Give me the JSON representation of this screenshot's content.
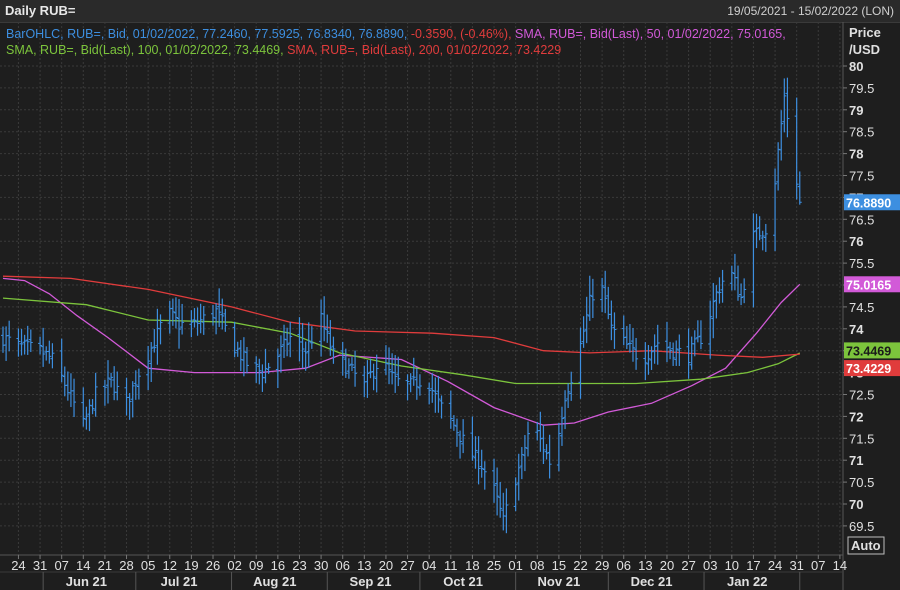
{
  "header": {
    "title": "Daily RUB=",
    "date_range": "19/05/2021 - 15/02/2022 (LON)"
  },
  "legend": {
    "line1": [
      {
        "text": "BarOHLC, RUB=, Bid, 01/02/2022, 77.2460, 77.5925, 76.8340, 76.8890, ",
        "color": "#3d8fe0"
      },
      {
        "text": "-0.3590, (-0.46%), ",
        "color": "#e03c3c"
      },
      {
        "text": "SMA, RUB=, Bid(Last),  50, 01/02/2022, 75.0165,",
        "color": "#d25ad8"
      }
    ],
    "line2": [
      {
        "text": "SMA, RUB=, Bid(Last),  100, 01/02/2022, 73.4469, ",
        "color": "#7cc43c"
      },
      {
        "text": "SMA, RUB=, Bid(Last),  200, 01/02/2022, 73.4229",
        "color": "#e03c3c"
      }
    ]
  },
  "axis": {
    "y_title_1": "Price",
    "y_title_2": "/USD",
    "auto_label": "Auto"
  },
  "tags": {
    "last": "76.8890",
    "sma50": "75.0165",
    "sma100": "73.4469",
    "sma200": "73.4229"
  },
  "colors": {
    "bars": "#3d8fe0",
    "sma50": "#d25ad8",
    "sma100": "#7cc43c",
    "sma200": "#e03c3c",
    "background": "#1e1e1e",
    "grid": "#3a3a3a"
  },
  "chart_data": {
    "type": "ohlc_bar",
    "title": "Daily RUB=",
    "ylabel": "Price /USD",
    "ylim": [
      69,
      80.5
    ],
    "ytick_labels": [
      "69.5",
      "70",
      "70.5",
      "71",
      "71.5",
      "72",
      "72.5",
      "73",
      "73.5",
      "74",
      "74.5",
      "75",
      "75.5",
      "76",
      "76.5",
      "77",
      "77.5",
      "78",
      "78.5",
      "79",
      "79.5",
      "80"
    ],
    "x_range": [
      "2021-05-19",
      "2022-02-15"
    ],
    "day_ticks": [
      "24",
      "31",
      "07",
      "14",
      "21",
      "28",
      "05",
      "12",
      "19",
      "26",
      "02",
      "09",
      "16",
      "23",
      "30",
      "06",
      "13",
      "20",
      "27",
      "04",
      "11",
      "18",
      "25",
      "01",
      "08",
      "15",
      "22",
      "29",
      "06",
      "13",
      "20",
      "27",
      "03",
      "10",
      "17",
      "24",
      "31",
      "07",
      "14"
    ],
    "day_tick_dates": [
      "2021-05-24",
      "2021-05-31",
      "2021-06-07",
      "2021-06-14",
      "2021-06-21",
      "2021-06-28",
      "2021-07-05",
      "2021-07-12",
      "2021-07-19",
      "2021-07-26",
      "2021-08-02",
      "2021-08-09",
      "2021-08-16",
      "2021-08-23",
      "2021-08-30",
      "2021-09-06",
      "2021-09-13",
      "2021-09-20",
      "2021-09-27",
      "2021-10-04",
      "2021-10-11",
      "2021-10-18",
      "2021-10-25",
      "2021-11-01",
      "2021-11-08",
      "2021-11-15",
      "2021-11-22",
      "2021-11-29",
      "2021-12-06",
      "2021-12-13",
      "2021-12-20",
      "2021-12-27",
      "2022-01-03",
      "2022-01-10",
      "2022-01-17",
      "2022-01-24",
      "2022-01-31",
      "2022-02-07",
      "2022-02-14"
    ],
    "month_labels": [
      "Jun 21",
      "Jul 21",
      "Aug 21",
      "Sep 21",
      "Oct 21",
      "Nov 21",
      "Dec 21",
      "Jan 22"
    ],
    "month_label_dates": [
      "2021-06-15",
      "2021-07-15",
      "2021-08-15",
      "2021-09-15",
      "2021-10-15",
      "2021-11-15",
      "2021-12-15",
      "2022-01-15"
    ],
    "last_bar": {
      "date": "2022-02-01",
      "open": 77.246,
      "high": 77.5925,
      "low": 76.834,
      "close": 76.889,
      "change": -0.359,
      "change_pct": -0.46
    },
    "close_anchors": [
      [
        "2021-05-19",
        73.8
      ],
      [
        "2021-05-24",
        73.6
      ],
      [
        "2021-05-31",
        73.5
      ],
      [
        "2021-06-04",
        73.3
      ],
      [
        "2021-06-09",
        72.6
      ],
      [
        "2021-06-14",
        71.8
      ],
      [
        "2021-06-18",
        72.5
      ],
      [
        "2021-06-23",
        72.8
      ],
      [
        "2021-06-28",
        72.3
      ],
      [
        "2021-07-02",
        73.0
      ],
      [
        "2021-07-07",
        73.7
      ],
      [
        "2021-07-11",
        74.4
      ],
      [
        "2021-07-15",
        74.1
      ],
      [
        "2021-07-20",
        74.1
      ],
      [
        "2021-07-27",
        74.4
      ],
      [
        "2021-08-02",
        73.6
      ],
      [
        "2021-08-06",
        73.2
      ],
      [
        "2021-08-11",
        73.0
      ],
      [
        "2021-08-15",
        73.3
      ],
      [
        "2021-08-20",
        73.8
      ],
      [
        "2021-08-25",
        73.5
      ],
      [
        "2021-08-30",
        74.2
      ],
      [
        "2021-09-03",
        73.4
      ],
      [
        "2021-09-08",
        73.1
      ],
      [
        "2021-09-13",
        72.7
      ],
      [
        "2021-09-18",
        73.3
      ],
      [
        "2021-09-23",
        72.8
      ],
      [
        "2021-09-28",
        72.7
      ],
      [
        "2021-10-03",
        72.9
      ],
      [
        "2021-10-07",
        72.3
      ],
      [
        "2021-10-12",
        71.8
      ],
      [
        "2021-10-17",
        71.2
      ],
      [
        "2021-10-21",
        70.9
      ],
      [
        "2021-10-25",
        70.3
      ],
      [
        "2021-10-28",
        69.6
      ],
      [
        "2021-10-31",
        70.4
      ],
      [
        "2021-11-03",
        71.0
      ],
      [
        "2021-11-06",
        71.9
      ],
      [
        "2021-11-10",
        71.3
      ],
      [
        "2021-11-13",
        70.8
      ],
      [
        "2021-11-17",
        72.5
      ],
      [
        "2021-11-21",
        73.3
      ],
      [
        "2021-11-25",
        74.6
      ],
      [
        "2021-11-28",
        75.2
      ],
      [
        "2021-12-02",
        74.0
      ],
      [
        "2021-12-07",
        73.6
      ],
      [
        "2021-12-12",
        73.3
      ],
      [
        "2021-12-17",
        73.7
      ],
      [
        "2021-12-22",
        73.5
      ],
      [
        "2021-12-27",
        73.4
      ],
      [
        "2022-01-01",
        73.9
      ],
      [
        "2022-01-05",
        74.8
      ],
      [
        "2022-01-09",
        75.4
      ],
      [
        "2022-01-13",
        74.7
      ],
      [
        "2022-01-17",
        76.1
      ],
      [
        "2022-01-21",
        76.3
      ],
      [
        "2022-01-24",
        77.4
      ],
      [
        "2022-01-27",
        79.3
      ],
      [
        "2022-01-29",
        78.4
      ],
      [
        "2022-02-01",
        76.889
      ]
    ],
    "series": [
      {
        "name": "SMA 50",
        "color": "#d25ad8",
        "points": [
          [
            "2021-05-19",
            75.15
          ],
          [
            "2021-05-26",
            75.1
          ],
          [
            "2021-06-03",
            74.8
          ],
          [
            "2021-06-12",
            74.3
          ],
          [
            "2021-06-22",
            73.8
          ],
          [
            "2021-07-05",
            73.1
          ],
          [
            "2021-07-20",
            73.0
          ],
          [
            "2021-08-10",
            73.0
          ],
          [
            "2021-08-25",
            73.1
          ],
          [
            "2021-09-05",
            73.4
          ],
          [
            "2021-09-25",
            73.3
          ],
          [
            "2021-10-10",
            72.8
          ],
          [
            "2021-10-25",
            72.2
          ],
          [
            "2021-11-10",
            71.8
          ],
          [
            "2021-11-20",
            71.85
          ],
          [
            "2021-12-01",
            72.1
          ],
          [
            "2021-12-15",
            72.3
          ],
          [
            "2021-12-28",
            72.7
          ],
          [
            "2022-01-08",
            73.1
          ],
          [
            "2022-01-18",
            73.9
          ],
          [
            "2022-01-26",
            74.6
          ],
          [
            "2022-02-01",
            75.0165
          ]
        ]
      },
      {
        "name": "SMA 100",
        "color": "#7cc43c",
        "points": [
          [
            "2021-05-19",
            74.7
          ],
          [
            "2021-06-15",
            74.55
          ],
          [
            "2021-07-05",
            74.2
          ],
          [
            "2021-08-01",
            74.15
          ],
          [
            "2021-08-20",
            73.9
          ],
          [
            "2021-09-05",
            73.45
          ],
          [
            "2021-09-25",
            73.15
          ],
          [
            "2021-10-15",
            72.95
          ],
          [
            "2021-11-01",
            72.75
          ],
          [
            "2021-11-20",
            72.75
          ],
          [
            "2021-12-10",
            72.75
          ],
          [
            "2021-12-31",
            72.85
          ],
          [
            "2022-01-15",
            73.0
          ],
          [
            "2022-01-25",
            73.2
          ],
          [
            "2022-02-01",
            73.4469
          ]
        ]
      },
      {
        "name": "SMA 200",
        "color": "#e03c3c",
        "points": [
          [
            "2021-05-19",
            75.2
          ],
          [
            "2021-06-10",
            75.15
          ],
          [
            "2021-07-05",
            74.9
          ],
          [
            "2021-08-01",
            74.5
          ],
          [
            "2021-08-20",
            74.15
          ],
          [
            "2021-09-10",
            73.95
          ],
          [
            "2021-10-05",
            73.9
          ],
          [
            "2021-10-25",
            73.8
          ],
          [
            "2021-11-10",
            73.5
          ],
          [
            "2021-11-25",
            73.45
          ],
          [
            "2021-12-15",
            73.5
          ],
          [
            "2022-01-05",
            73.4
          ],
          [
            "2022-01-20",
            73.35
          ],
          [
            "2022-02-01",
            73.4229
          ]
        ]
      }
    ]
  }
}
